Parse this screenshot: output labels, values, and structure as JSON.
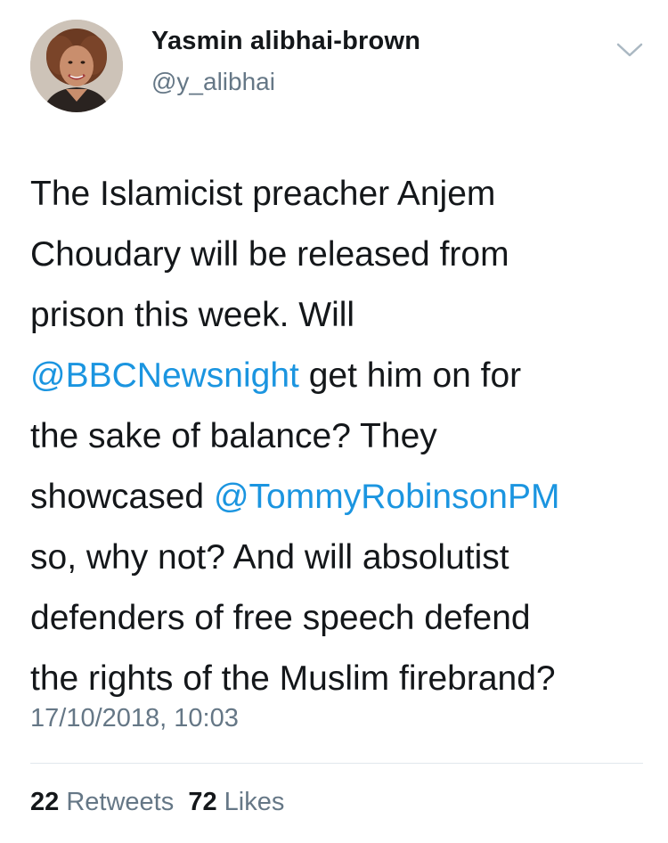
{
  "author": {
    "display_name": "Yasmin alibhai-brown",
    "handle": "@y_alibhai",
    "avatar_icon": "profile-photo"
  },
  "menu": {
    "icon": "chevron-down-icon",
    "color": "#aab8c2"
  },
  "tweet": {
    "lines": [
      [
        {
          "text": "The Islamicist preacher Anjem"
        }
      ],
      [
        {
          "text": "Choudary will be released from"
        }
      ],
      [
        {
          "text": "prison this week. Will"
        }
      ],
      [
        {
          "text": "@BBCNewsnight",
          "mention": true
        },
        {
          "text": " get him on for"
        }
      ],
      [
        {
          "text": "the sake of balance? They"
        }
      ],
      [
        {
          "text": "showcased "
        },
        {
          "text": "@TommyRobinsonPM",
          "mention": true
        }
      ],
      [
        {
          "text": "so, why not? And will absolutist"
        }
      ],
      [
        {
          "text": "defenders of free speech defend"
        }
      ],
      [
        {
          "text": "the rights of the Muslim firebrand?"
        }
      ]
    ],
    "timestamp": "17/10/2018, 10:03"
  },
  "stats": {
    "retweets_count": "22",
    "retweets_label": "Retweets",
    "likes_count": "72",
    "likes_label": "Likes"
  },
  "colors": {
    "text": "#14171a",
    "secondary": "#657786",
    "link": "#1b95e0",
    "divider": "#e1e8ed"
  }
}
